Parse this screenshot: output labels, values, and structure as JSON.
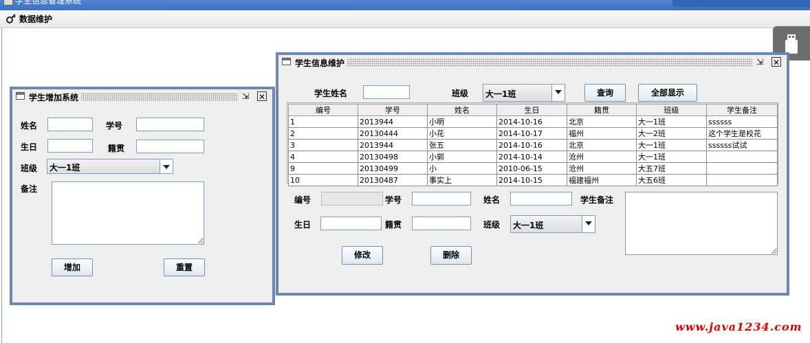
{
  "app": {
    "title": "学生信息管理系统"
  },
  "menu": {
    "data_maintenance": "数据维护"
  },
  "add_frame": {
    "title": "学生增加系统",
    "name_label": "姓名",
    "id_label": "学号",
    "birthday_label": "生日",
    "native_label": "籍贯",
    "class_label": "班级",
    "class_value": "大一1班",
    "remark_label": "备注",
    "add_button": "增加",
    "reset_button": "重置"
  },
  "maint_frame": {
    "title": "学生信息维护",
    "search_name_label": "学生姓名",
    "search_class_label": "班级",
    "search_class_value": "大一1班",
    "query_button": "查询",
    "show_all_button": "全部显示",
    "table": {
      "columns": [
        "编号",
        "学号",
        "姓名",
        "生日",
        "籍贯",
        "班级",
        "学生备注"
      ],
      "rows": [
        [
          "1",
          "2013944",
          "小明",
          "2014-10-16",
          "北京",
          "大一1班",
          "ssssss"
        ],
        [
          "2",
          "20130444",
          "小花",
          "2014-10-17",
          "福州",
          "大一2班",
          "这个学生是校花"
        ],
        [
          "3",
          "2013944",
          "张五",
          "2014-10-16",
          "北京",
          "大一1班",
          "ssssss试试"
        ],
        [
          "4",
          "20130498",
          "小郭",
          "2014-10-14",
          "沧州",
          "大一1班",
          ""
        ],
        [
          "9",
          "20130499",
          "小",
          "2010-06-15",
          "沧州",
          "大五7班",
          ""
        ],
        [
          "10",
          "20130487",
          "事实上",
          "2014-10-15",
          "福建福州",
          "大五6班",
          ""
        ]
      ]
    },
    "form": {
      "no_label": "编号",
      "id_label": "学号",
      "name_label": "姓名",
      "remark_label": "学生备注",
      "birthday_label": "生日",
      "native_label": "籍贯",
      "class_label": "班级",
      "class_value": "大一1班",
      "modify_button": "修改",
      "delete_button": "删除"
    }
  },
  "watermark": "www.java1234.com"
}
